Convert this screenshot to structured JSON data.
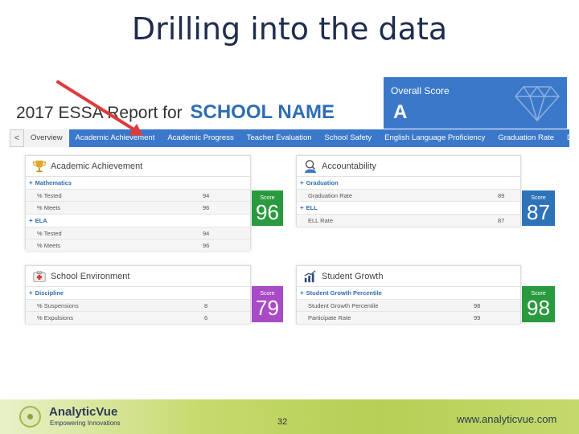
{
  "slide": {
    "title": "Drilling into the data",
    "page_number": "32"
  },
  "report": {
    "title_prefix": "2017 ESSA Report for",
    "school_name": "SCHOOL NAME"
  },
  "overall": {
    "label": "Overall Score",
    "grade": "A"
  },
  "tabs": [
    {
      "label": "Overview",
      "active": true
    },
    {
      "label": "Academic Achievement"
    },
    {
      "label": "Academic Progress"
    },
    {
      "label": "Teacher Evaluation"
    },
    {
      "label": "School Safety"
    },
    {
      "label": "English Language Proficiency"
    },
    {
      "label": "Graduation Rate"
    },
    {
      "label": "Di"
    }
  ],
  "nav": {
    "prev_glyph": "<"
  },
  "cards": {
    "academic": {
      "title": "Academic Achievement",
      "score_label": "Score",
      "score": "96",
      "score_color": "#2a9a3e",
      "rows": [
        {
          "type": "group",
          "label": "Mathematics"
        },
        {
          "type": "metric",
          "label": "% Tested",
          "value": "94"
        },
        {
          "type": "metric",
          "label": "% Meets",
          "value": "96"
        },
        {
          "type": "group",
          "label": "ELA"
        },
        {
          "type": "metric",
          "label": "% Tested",
          "value": "94"
        },
        {
          "type": "metric",
          "label": "% Meets",
          "value": "96"
        }
      ]
    },
    "accountability": {
      "title": "Accountability",
      "score_label": "Score",
      "score": "87",
      "score_color": "#2e73b8",
      "rows": [
        {
          "type": "group",
          "label": "Graduation"
        },
        {
          "type": "metric",
          "label": "Graduation Rate",
          "value": "89"
        },
        {
          "type": "group",
          "label": "ELL"
        },
        {
          "type": "metric",
          "label": "ELL Rate",
          "value": "87"
        }
      ]
    },
    "environment": {
      "title": "School Environment",
      "score_label": "Score",
      "score": "79",
      "score_color": "#a94bc6",
      "rows": [
        {
          "type": "group",
          "label": "Discipline"
        },
        {
          "type": "metric",
          "label": "% Suspensions",
          "value": "8"
        },
        {
          "type": "metric",
          "label": "% Expulsions",
          "value": "6"
        }
      ]
    },
    "growth": {
      "title": "Student Growth",
      "score_label": "Score",
      "score": "98",
      "score_color": "#2a9a3e",
      "rows": [
        {
          "type": "group",
          "label": "Student Growth Percentile"
        },
        {
          "type": "metric",
          "label": "Student Growth Percentile",
          "value": "98"
        },
        {
          "type": "metric",
          "label": "Participate Rate",
          "value": "99"
        }
      ]
    }
  },
  "footer": {
    "brand": "AnalyticVue",
    "tagline": "Empowering Innovations",
    "website": "www.analyticvue.com"
  },
  "colors": {
    "accent": "#3b78c9",
    "arrow": "#e03b3b"
  }
}
